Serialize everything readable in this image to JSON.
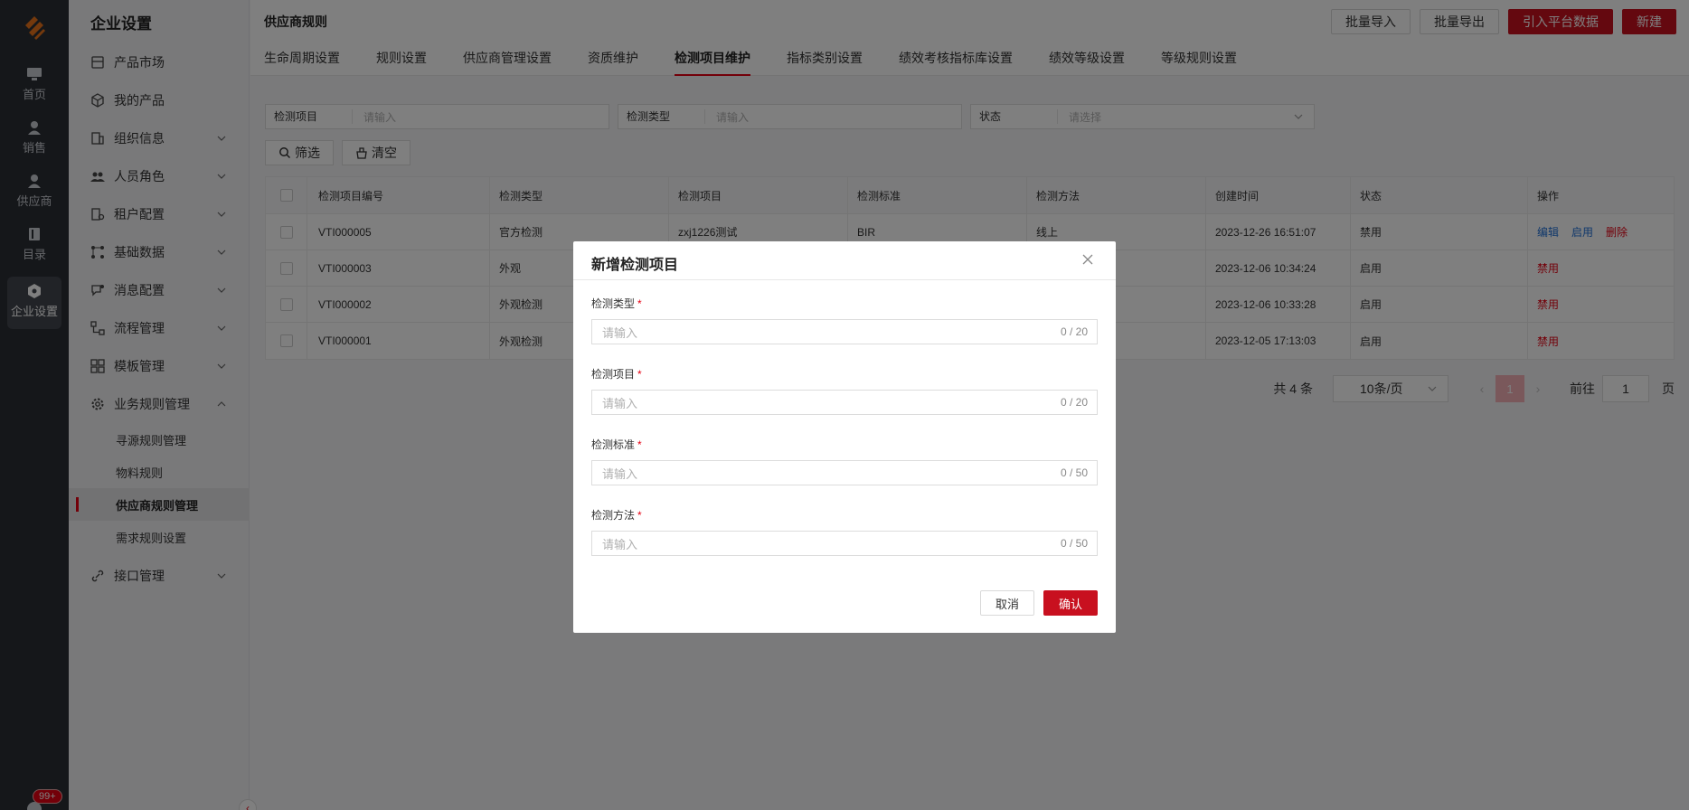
{
  "rail": {
    "items": [
      {
        "label": "首页",
        "icon": "monitor-icon"
      },
      {
        "label": "销售",
        "icon": "user-icon"
      },
      {
        "label": "供应商",
        "icon": "supplier-icon"
      },
      {
        "label": "目录",
        "icon": "book-icon"
      },
      {
        "label": "企业设置",
        "icon": "hexagon-gear-icon"
      }
    ],
    "badge": "99+"
  },
  "sidebar": {
    "title": "企业设置",
    "items": [
      {
        "label": "产品市场",
        "icon": "market-icon"
      },
      {
        "label": "我的产品",
        "icon": "cube-icon"
      },
      {
        "label": "组织信息",
        "icon": "building-icon"
      },
      {
        "label": "人员角色",
        "icon": "people-icon"
      },
      {
        "label": "租户配置",
        "icon": "tenant-icon"
      },
      {
        "label": "基础数据",
        "icon": "data-icon"
      },
      {
        "label": "消息配置",
        "icon": "message-icon"
      },
      {
        "label": "流程管理",
        "icon": "flow-icon"
      },
      {
        "label": "模板管理",
        "icon": "template-icon"
      },
      {
        "label": "业务规则管理",
        "icon": "gear-icon"
      },
      {
        "label": "接口管理",
        "icon": "link-icon"
      }
    ],
    "subitems": [
      "寻源规则管理",
      "物料规则",
      "供应商规则管理",
      "需求规则设置"
    ]
  },
  "header": {
    "title": "供应商规则",
    "buttons": {
      "import": "批量导入",
      "export": "批量导出",
      "platform": "引入平台数据",
      "create": "新建"
    },
    "tabs": [
      "生命周期设置",
      "规则设置",
      "供应商管理设置",
      "资质维护",
      "检测项目维护",
      "指标类别设置",
      "绩效考核指标库设置",
      "绩效等级设置",
      "等级规则设置"
    ]
  },
  "filters": {
    "item": {
      "label": "检测项目",
      "placeholder": "请输入"
    },
    "type": {
      "label": "检测类型",
      "placeholder": "请输入"
    },
    "status": {
      "label": "状态",
      "placeholder": "请选择"
    },
    "filter_btn": "筛选",
    "clear_btn": "清空"
  },
  "table": {
    "columns": [
      "检测项目编号",
      "检测类型",
      "检测项目",
      "检测标准",
      "检测方法",
      "创建时间",
      "状态",
      "操作"
    ],
    "rows": [
      {
        "code": "VTI000005",
        "type": "官方检测",
        "item": "zxj1226测试",
        "standard": "BIR",
        "method": "线上",
        "created": "2023-12-26 16:51:07",
        "status": "禁用",
        "ops": [
          "编辑",
          "启用",
          "删除"
        ]
      },
      {
        "code": "VTI000003",
        "type": "外观",
        "item": "",
        "standard": "",
        "method": "",
        "created": "2023-12-06 10:34:24",
        "status": "启用",
        "ops": [
          "禁用"
        ]
      },
      {
        "code": "VTI000002",
        "type": "外观检测",
        "item": "",
        "standard": "",
        "method": "",
        "created": "2023-12-06 10:33:28",
        "status": "启用",
        "ops": [
          "禁用"
        ]
      },
      {
        "code": "VTI000001",
        "type": "外观检测",
        "item": "",
        "standard": "",
        "method": "",
        "created": "2023-12-05 17:13:03",
        "status": "启用",
        "ops": [
          "禁用"
        ]
      }
    ]
  },
  "pagination": {
    "total": "共 4 条",
    "page_size": "10条/页",
    "current": "1",
    "goto_label": "前往",
    "goto_value": "1",
    "page_suffix": "页"
  },
  "dialog": {
    "title": "新增检测项目",
    "fields": [
      {
        "label": "检测类型",
        "placeholder": "请输入",
        "counter": "0 / 20"
      },
      {
        "label": "检测项目",
        "placeholder": "请输入",
        "counter": "0 / 20"
      },
      {
        "label": "检测标准",
        "placeholder": "请输入",
        "counter": "0 / 50"
      },
      {
        "label": "检测方法",
        "placeholder": "请输入",
        "counter": "0 / 50"
      }
    ],
    "required_mark": "*",
    "cancel": "取消",
    "confirm": "确认"
  },
  "colors": {
    "accent": "#e60012",
    "brand_button": "#c8101f",
    "link": "#1f6fd6",
    "rail": "#2b2e35"
  }
}
